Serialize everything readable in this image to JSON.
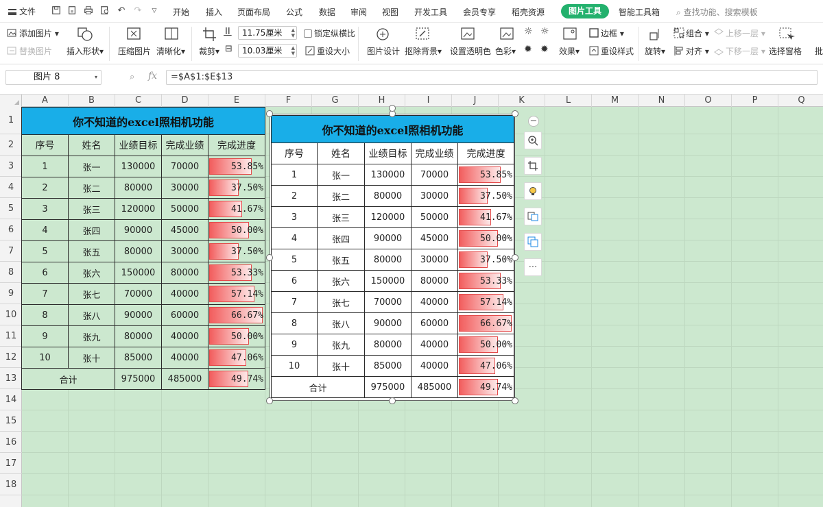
{
  "menubar": {
    "file": "文件",
    "tabs": [
      "开始",
      "插入",
      "页面布局",
      "公式",
      "数据",
      "审阅",
      "视图",
      "开发工具",
      "会员专享",
      "稻壳资源"
    ],
    "active_tab": "图片工具",
    "extra_tab": "智能工具箱",
    "search": "查找功能、搜索模板"
  },
  "ribbon": {
    "add_picture": "添加图片",
    "replace_picture": "替换图片",
    "insert_shape": "插入形状",
    "compress": "压缩图片",
    "sharpen": "清晰化",
    "crop": "裁剪",
    "width_value": "11.75厘米",
    "height_value": "10.03厘米",
    "lock_ratio": "锁定纵横比",
    "reset_size": "重设大小",
    "picture_design": "图片设计",
    "remove_bg": "抠除背景",
    "set_transparent": "设置透明色",
    "color": "色彩",
    "effects": "效果",
    "border": "边框",
    "reset_style": "重设样式",
    "rotate": "旋转",
    "group": "组合",
    "align": "对齐",
    "bring_forward": "上移一层",
    "send_backward": "下移一层",
    "selection_pane": "选择窗格",
    "batch": "批"
  },
  "formula_bar": {
    "name_box": "图片 8",
    "formula": "=$A$1:$E$13"
  },
  "columns": [
    "A",
    "B",
    "C",
    "D",
    "E",
    "F",
    "G",
    "H",
    "I",
    "J",
    "K",
    "L",
    "M",
    "N",
    "O",
    "P",
    "Q"
  ],
  "rows": [
    "1",
    "2",
    "3",
    "4",
    "5",
    "6",
    "7",
    "8",
    "9",
    "10",
    "11",
    "12",
    "13",
    "14",
    "15",
    "16",
    "17",
    "18"
  ],
  "table": {
    "title": "你不知道的excel照相机功能",
    "headers": [
      "序号",
      "姓名",
      "业绩目标",
      "完成业绩",
      "完成进度"
    ],
    "rows": [
      {
        "no": "1",
        "name": "张一",
        "target": "130000",
        "done": "70000",
        "progress": "53.85%",
        "fill": 0.5385
      },
      {
        "no": "2",
        "name": "张二",
        "target": "80000",
        "done": "30000",
        "progress": "37.50%",
        "fill": 0.375
      },
      {
        "no": "3",
        "name": "张三",
        "target": "120000",
        "done": "50000",
        "progress": "41.67%",
        "fill": 0.4167
      },
      {
        "no": "4",
        "name": "张四",
        "target": "90000",
        "done": "45000",
        "progress": "50.00%",
        "fill": 0.5
      },
      {
        "no": "5",
        "name": "张五",
        "target": "80000",
        "done": "30000",
        "progress": "37.50%",
        "fill": 0.375
      },
      {
        "no": "6",
        "name": "张六",
        "target": "150000",
        "done": "80000",
        "progress": "53.33%",
        "fill": 0.5333
      },
      {
        "no": "7",
        "name": "张七",
        "target": "70000",
        "done": "40000",
        "progress": "57.14%",
        "fill": 0.5714
      },
      {
        "no": "8",
        "name": "张八",
        "target": "90000",
        "done": "60000",
        "progress": "66.67%",
        "fill": 0.6667
      },
      {
        "no": "9",
        "name": "张九",
        "target": "80000",
        "done": "40000",
        "progress": "50.00%",
        "fill": 0.5
      },
      {
        "no": "10",
        "name": "张十",
        "target": "85000",
        "done": "40000",
        "progress": "47.06%",
        "fill": 0.4706
      }
    ],
    "total": {
      "label": "合计",
      "target": "975000",
      "done": "485000",
      "progress": "49.74%",
      "fill": 0.4974
    },
    "title_color": "#19aee8",
    "databar_color": "#f25d5d"
  },
  "floating_tools": [
    "zoom-out-icon",
    "zoom-in-icon",
    "crop-icon",
    "bulb-icon",
    "image-convert-icon",
    "image-extract-icon",
    "more-icon"
  ]
}
